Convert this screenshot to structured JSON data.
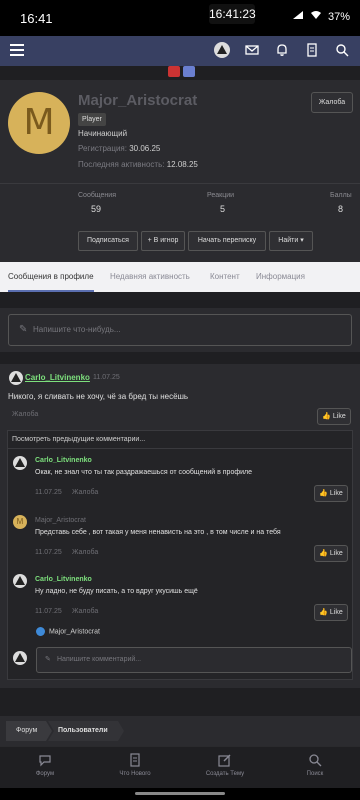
{
  "statusbar": {
    "time": "16:41",
    "center_time": "16:41:23",
    "battery": "37%"
  },
  "profile": {
    "avatar_letter": "M",
    "username": "Major_Aristocrat",
    "badge": "Player",
    "rank": "Начинающий",
    "registration_label": "Регистрация:",
    "registration_date": "30.06.25",
    "last_activity_label": "Последняя активность:",
    "last_activity_date": "12.08.25",
    "report_label": "Жалоба",
    "stats": [
      {
        "label": "Сообщения",
        "value": "59"
      },
      {
        "label": "Реакции",
        "value": "5"
      },
      {
        "label": "Баллы",
        "value": "8"
      }
    ],
    "actions": {
      "subscribe": "Подписаться",
      "ignore": "+ В игнор",
      "start_conversation": "Начать переписку",
      "find": "Найти"
    }
  },
  "tabs": [
    "Сообщения в профиле",
    "Недавняя активность",
    "Контент",
    "Информация"
  ],
  "composer": {
    "placeholder": "Напишите что-нибудь..."
  },
  "post": {
    "author": "Carlo_Litvinenko",
    "date": "11.07.25",
    "text": "Никого, я сливать не хочу, чё за бред ты несёшь",
    "report_label": "Жалоба",
    "like_label": "Like",
    "prev_comments": "Посмотреть предыдущие комментарии...",
    "comments": [
      {
        "author": "Carlo_Litvinenko",
        "text": "Окак, не знал что ты так раздражаешься от сообщений в профиле",
        "date": "11.07.25",
        "report": "Жалоба",
        "like": "Like"
      },
      {
        "author": "Major_Aristocrat",
        "text": "Представь себе , вот такая у меня ненависть на это , в том числе и на тебя",
        "date": "11.07.25",
        "report": "Жалоба",
        "like": "Like"
      },
      {
        "author": "Carlo_Litvinenko",
        "text": "Ну ладно, не буду писать, а то вдруг укусишь ещё",
        "date": "11.07.25",
        "report": "Жалоба",
        "like": "Like"
      }
    ],
    "likers": "Major_Aristocrat",
    "comment_placeholder": "Напишите комментарий..."
  },
  "breadcrumb": [
    "Форум",
    "Пользователи"
  ],
  "bottomnav": [
    "Форум",
    "Что Нового",
    "Создать Тему",
    "Поиск"
  ]
}
